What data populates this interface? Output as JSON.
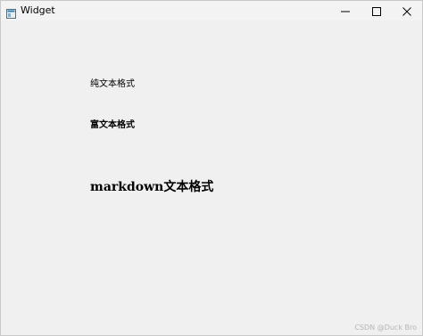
{
  "window": {
    "title": "Widget",
    "icons": {
      "app": "app-window-icon",
      "minimize": "minimize-icon",
      "maximize": "maximize-icon",
      "close": "close-icon"
    }
  },
  "labels": {
    "plain_text": "纯文本格式",
    "rich_text": "富文本格式",
    "markdown_text": "markdown文本格式"
  },
  "watermark": "CSDN @Duck Bro",
  "colors": {
    "window_background": "#f0f0f0",
    "titlebar_background": "#f3f3f3",
    "text": "#000000",
    "watermark": "#b5b5b5"
  }
}
